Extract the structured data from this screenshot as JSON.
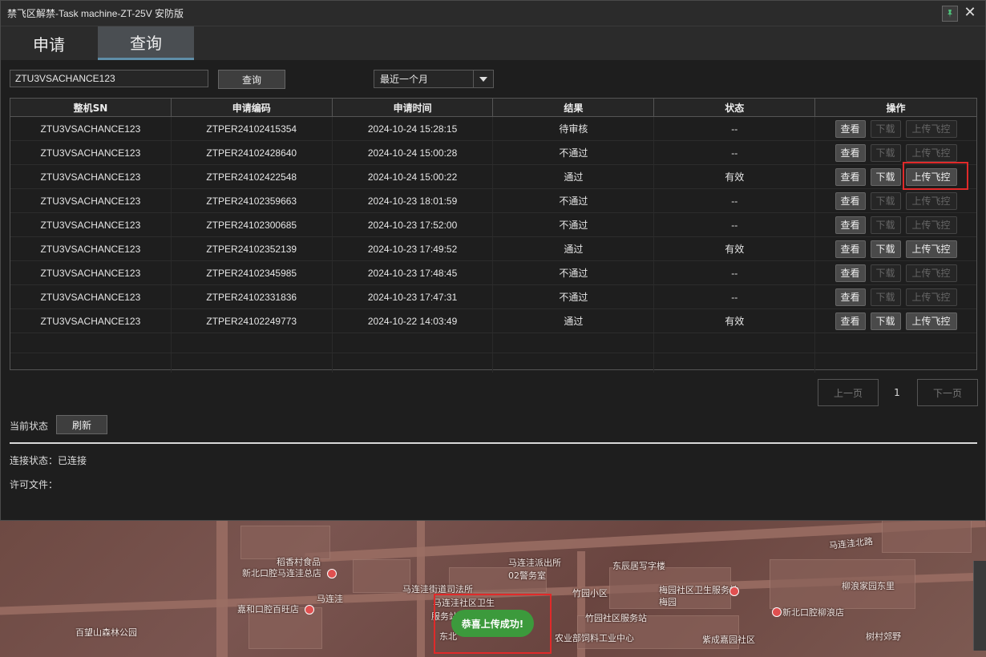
{
  "window": {
    "title": "禁飞区解禁-Task machine-ZT-25V 安防版",
    "close_glyph": "✕"
  },
  "tabs": [
    {
      "label": "申请",
      "active": false
    },
    {
      "label": "查询",
      "active": true
    }
  ],
  "query": {
    "sn_value": "ZTU3VSACHANCE123",
    "query_button": "查询",
    "range_selected": "最近一个月"
  },
  "table": {
    "headers": [
      "整机SN",
      "申请编码",
      "申请时间",
      "结果",
      "状态",
      "操作"
    ],
    "rows": [
      {
        "sn": "ZTU3VSACHANCE123",
        "code": "ZTPER24102415354",
        "time": "2024-10-24 15:28:15",
        "result": "待审核",
        "status": "--",
        "view": "查看",
        "download": "下载",
        "upload": "上传飞控",
        "enabled": false
      },
      {
        "sn": "ZTU3VSACHANCE123",
        "code": "ZTPER24102428640",
        "time": "2024-10-24 15:00:28",
        "result": "不通过",
        "status": "--",
        "view": "查看",
        "download": "下载",
        "upload": "上传飞控",
        "enabled": false
      },
      {
        "sn": "ZTU3VSACHANCE123",
        "code": "ZTPER24102422548",
        "time": "2024-10-24 15:00:22",
        "result": "通过",
        "status": "有效",
        "view": "查看",
        "download": "下载",
        "upload": "上传飞控",
        "enabled": true
      },
      {
        "sn": "ZTU3VSACHANCE123",
        "code": "ZTPER24102359663",
        "time": "2024-10-23 18:01:59",
        "result": "不通过",
        "status": "--",
        "view": "查看",
        "download": "下载",
        "upload": "上传飞控",
        "enabled": false
      },
      {
        "sn": "ZTU3VSACHANCE123",
        "code": "ZTPER24102300685",
        "time": "2024-10-23 17:52:00",
        "result": "不通过",
        "status": "--",
        "view": "查看",
        "download": "下载",
        "upload": "上传飞控",
        "enabled": false
      },
      {
        "sn": "ZTU3VSACHANCE123",
        "code": "ZTPER24102352139",
        "time": "2024-10-23 17:49:52",
        "result": "通过",
        "status": "有效",
        "view": "查看",
        "download": "下载",
        "upload": "上传飞控",
        "enabled": true
      },
      {
        "sn": "ZTU3VSACHANCE123",
        "code": "ZTPER24102345985",
        "time": "2024-10-23 17:48:45",
        "result": "不通过",
        "status": "--",
        "view": "查看",
        "download": "下载",
        "upload": "上传飞控",
        "enabled": false
      },
      {
        "sn": "ZTU3VSACHANCE123",
        "code": "ZTPER24102331836",
        "time": "2024-10-23 17:47:31",
        "result": "不通过",
        "status": "--",
        "view": "查看",
        "download": "下载",
        "upload": "上传飞控",
        "enabled": false
      },
      {
        "sn": "ZTU3VSACHANCE123",
        "code": "ZTPER24102249773",
        "time": "2024-10-22 14:03:49",
        "result": "通过",
        "status": "有效",
        "view": "查看",
        "download": "下载",
        "upload": "上传飞控",
        "enabled": true
      }
    ]
  },
  "pager": {
    "prev": "上一页",
    "page": "1",
    "next": "下一页"
  },
  "status": {
    "current_label": "当前状态",
    "refresh": "刷新",
    "connection": "连接状态：已连接",
    "license": "许可文件："
  },
  "map": {
    "labels": [
      "马连洼派出所",
      "02警务室",
      "马连洼北路",
      "新北口腔马连洼总店",
      "马连洼街道司法所",
      "马连洼社区卫生",
      "服务站",
      "马连洼",
      "嘉和口腔百旺店",
      "竹园小区",
      "梅园社区卫生服务站",
      "梅园",
      "新北口腔柳浪店",
      "竹园社区服务站",
      "百望山森林公园",
      "农业部饲料工业中心",
      "紫成嘉园社区",
      "东北",
      "东辰居写字楼",
      "树村郊野",
      "柳浪家园东里",
      "稻香村食品"
    ],
    "toast": "恭喜上传成功!"
  },
  "colors": {
    "accent": "#5f8ea8",
    "highlight": "#e02a2a",
    "toast": "#3c9a3c"
  }
}
